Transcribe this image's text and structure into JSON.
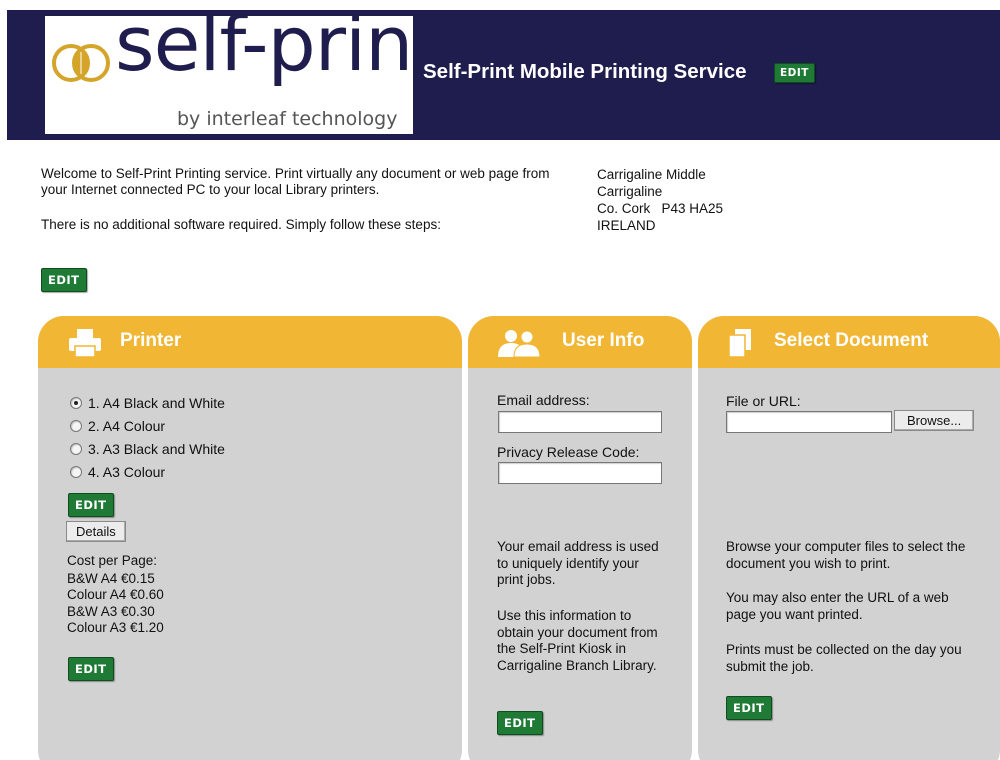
{
  "header": {
    "logo_text": "self-print",
    "logo_sub": "by interleaf technology",
    "title": "Self-Print Mobile Printing Service",
    "edit": "EDIT"
  },
  "intro": {
    "line1": "Welcome to Self-Print Printing service. Print virtually any document or web page from your Internet connected PC to your local Library printers.",
    "line2": "There is no additional software required. Simply follow these steps:",
    "edit": "EDIT"
  },
  "address": [
    "Carrigaline Middle",
    "Carrigaline",
    "Co. Cork   P43 HA25",
    "IRELAND"
  ],
  "printer": {
    "title": "Printer",
    "options": [
      {
        "label": "1. A4 Black and White",
        "selected": true
      },
      {
        "label": "2. A4 Colour",
        "selected": false
      },
      {
        "label": "3. A3 Black and White",
        "selected": false
      },
      {
        "label": "4. A3 Colour",
        "selected": false
      }
    ],
    "edit": "EDIT",
    "details_button": "Details",
    "cost_heading": "Cost per Page:",
    "costs": [
      "B&W A4 €0.15",
      "Colour A4 €0.60",
      "B&W A3 €0.30",
      "Colour A3 €1.20"
    ],
    "edit2": "EDIT"
  },
  "user_info": {
    "title": "User Info",
    "email_label": "Email address:",
    "email_value": "",
    "code_label": "Privacy Release Code:",
    "code_value": "",
    "para1": "Your email address is used to uniquely identify your print jobs.",
    "para2": "Use this information to obtain your document from the Self-Print Kiosk in Carrigaline Branch Library.",
    "edit": "EDIT"
  },
  "select_document": {
    "title": "Select Document",
    "file_label": "File or URL:",
    "file_value": "",
    "browse_button": "Browse...",
    "para1": "Browse your computer files to select the document you wish to print.",
    "para2": "You may also enter the URL of a web page you want printed.",
    "para3": "Prints must be collected on the day you submit the job.",
    "edit": "EDIT"
  },
  "colors": {
    "header_bg": "#1e1d4d",
    "panel_head": "#f0b634",
    "panel_bg": "#d2d2d2",
    "edit_green": "#1f7a35"
  },
  "icons": [
    "printer-icon",
    "users-icon",
    "documents-icon",
    "logo-rings-icon"
  ]
}
